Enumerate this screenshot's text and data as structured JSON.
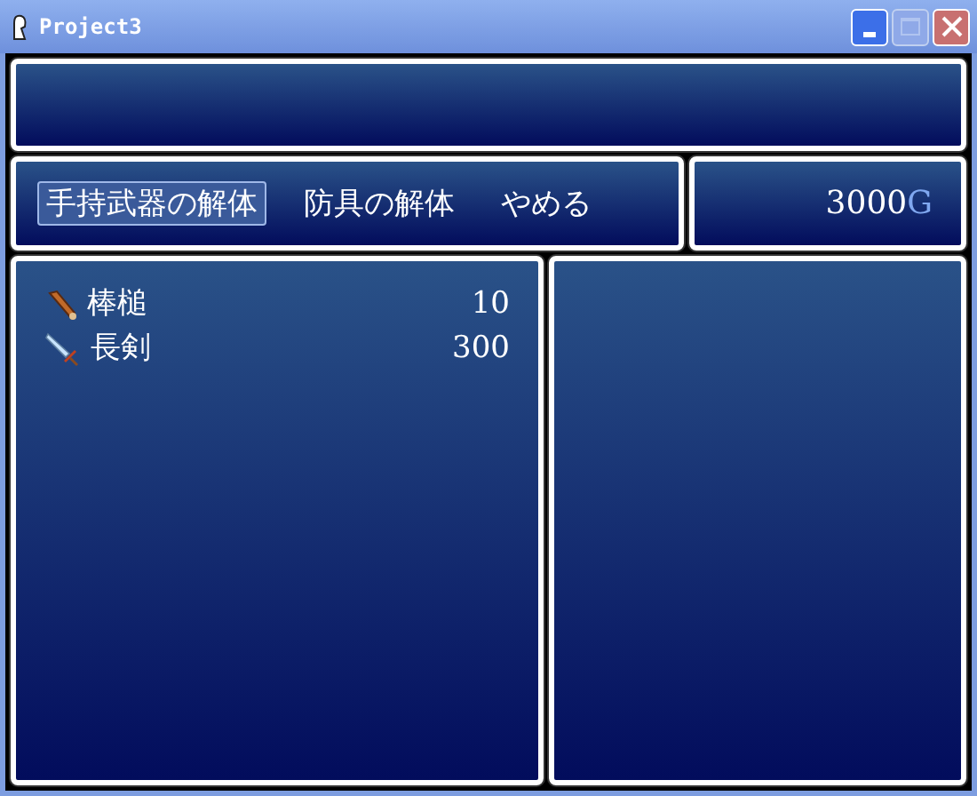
{
  "window": {
    "title": "Project3"
  },
  "commands": [
    {
      "label": "手持武器の解体",
      "selected": true
    },
    {
      "label": "防具の解体",
      "selected": false
    },
    {
      "label": "やめる",
      "selected": false
    }
  ],
  "gold": {
    "amount": "3000",
    "unit": "G"
  },
  "items": [
    {
      "kind": "club",
      "name": "棒槌",
      "count": "10"
    },
    {
      "kind": "sword",
      "name": "長剣",
      "count": "300"
    }
  ]
}
